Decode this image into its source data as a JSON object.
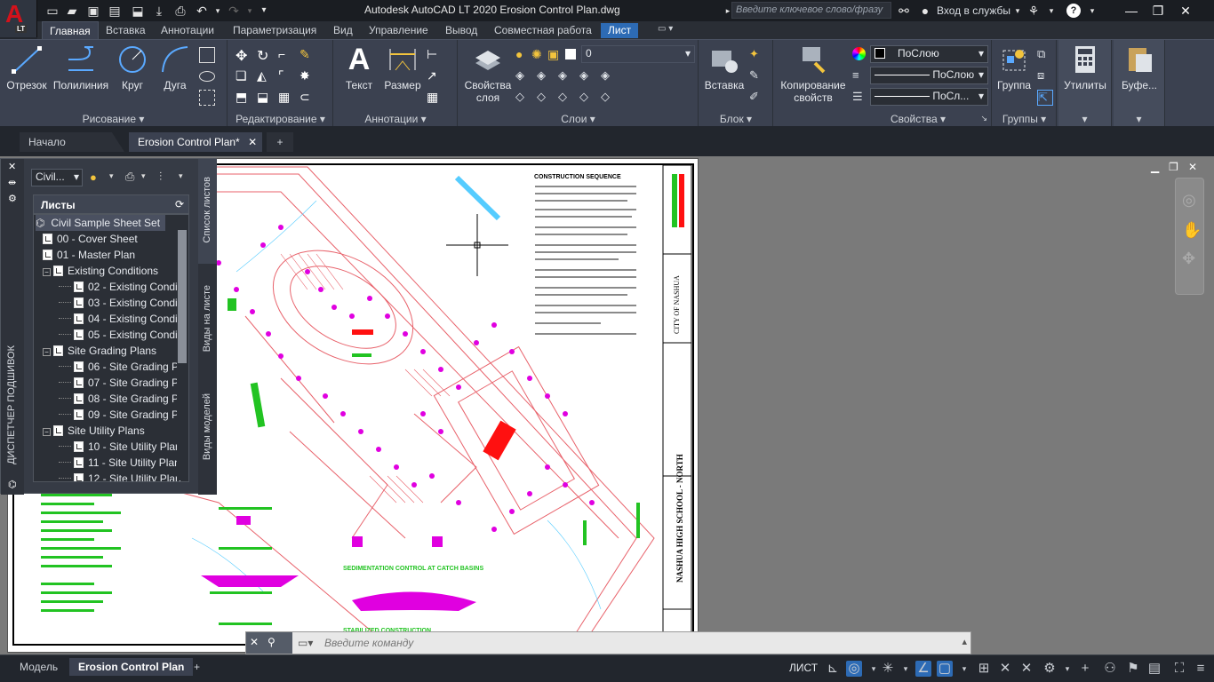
{
  "title_bar": {
    "app_badge": "LT",
    "title": "Autodesk AutoCAD LT 2020    Erosion Control Plan.dwg",
    "search_placeholder": "Введите ключевое слово/фразу",
    "sign_in": "Вход в службы",
    "help": "?"
  },
  "ribbon_tabs": [
    "Главная",
    "Вставка",
    "Аннотации",
    "Параметризация",
    "Вид",
    "Управление",
    "Вывод",
    "Совместная работа",
    "Лист"
  ],
  "ribbon": {
    "draw": {
      "title": "Рисование",
      "line": "Отрезок",
      "polyline": "Полилиния",
      "circle": "Круг",
      "arc": "Дуга"
    },
    "modify": {
      "title": "Редактирование"
    },
    "annotation": {
      "title": "Аннотации",
      "text": "Текст",
      "dimension": "Размер"
    },
    "layer_props": {
      "label1": "Свойства",
      "label2": "слоя"
    },
    "layers": {
      "title": "Слои",
      "current_layer": "0"
    },
    "block": {
      "title": "Блок",
      "insert": "Вставка"
    },
    "match": {
      "label1": "Копирование",
      "label2": "свойств"
    },
    "properties": {
      "title": "Свойства",
      "color": "ПоСлою",
      "linetype": "ПоСлою",
      "lineweight": "ПоСл..."
    },
    "groups": {
      "title": "Группы",
      "group": "Группа"
    },
    "utilities": {
      "label": "Утилиты"
    },
    "clipboard": {
      "label": "Буфе..."
    }
  },
  "doc_tabs": {
    "start": "Начало",
    "active": "Erosion Control Plan*",
    "add": "+"
  },
  "ssm": {
    "selector": "Civil...",
    "header": "Листы",
    "side_label": "ДИСПЕТЧЕР ПОДШИВОК",
    "vtabs": [
      "Список листов",
      "Виды на листе",
      "Виды моделей"
    ],
    "tree": [
      {
        "label": "Civil Sample Sheet Set",
        "level": 0,
        "kind": "root"
      },
      {
        "label": "00 - Cover Sheet",
        "level": 1,
        "kind": "sheet"
      },
      {
        "label": "01 - Master Plan",
        "level": 1,
        "kind": "sheet"
      },
      {
        "label": "Existing Conditions",
        "level": 1,
        "kind": "group"
      },
      {
        "label": "02 - Existing Condi",
        "level": 2,
        "kind": "sheet"
      },
      {
        "label": "03 - Existing Condi",
        "level": 2,
        "kind": "sheet"
      },
      {
        "label": "04 - Existing Condi",
        "level": 2,
        "kind": "sheet"
      },
      {
        "label": "05 - Existing Condi",
        "level": 2,
        "kind": "sheet"
      },
      {
        "label": "Site Grading Plans",
        "level": 1,
        "kind": "group"
      },
      {
        "label": "06 - Site Grading P",
        "level": 2,
        "kind": "sheet"
      },
      {
        "label": "07 - Site Grading P",
        "level": 2,
        "kind": "sheet"
      },
      {
        "label": "08 - Site Grading P",
        "level": 2,
        "kind": "sheet"
      },
      {
        "label": "09 - Site Grading P",
        "level": 2,
        "kind": "sheet"
      },
      {
        "label": "Site Utility Plans",
        "level": 1,
        "kind": "group"
      },
      {
        "label": "10 - Site Utility Plan",
        "level": 2,
        "kind": "sheet"
      },
      {
        "label": "11 - Site Utility Plan",
        "level": 2,
        "kind": "sheet"
      },
      {
        "label": "12 - Site Utility Plan",
        "level": 2,
        "kind": "sheet"
      }
    ]
  },
  "drawing": {
    "notes_title": "CONSTRUCTION SEQUENCE",
    "detail1": "SEDIMENTATION CONTROL AT CATCH BASINS",
    "detail2": "STABILIZED CONSTRUCTION",
    "title_block_1": "NASHUA HIGH SCHOOL - NORTH",
    "title_block_2": "CITY OF NASHUA"
  },
  "command": {
    "placeholder": "Введите команду"
  },
  "status": {
    "model": "Модель",
    "layout": "Erosion Control Plan",
    "space": "ЛИСТ"
  },
  "colors": {
    "accent": "#2d6bb5",
    "ribbon": "#3b4150",
    "titlebar": "#1a1d22",
    "plan_red": "#e8626b",
    "marker_magenta": "#e000e0",
    "detail_green": "#22c322"
  }
}
